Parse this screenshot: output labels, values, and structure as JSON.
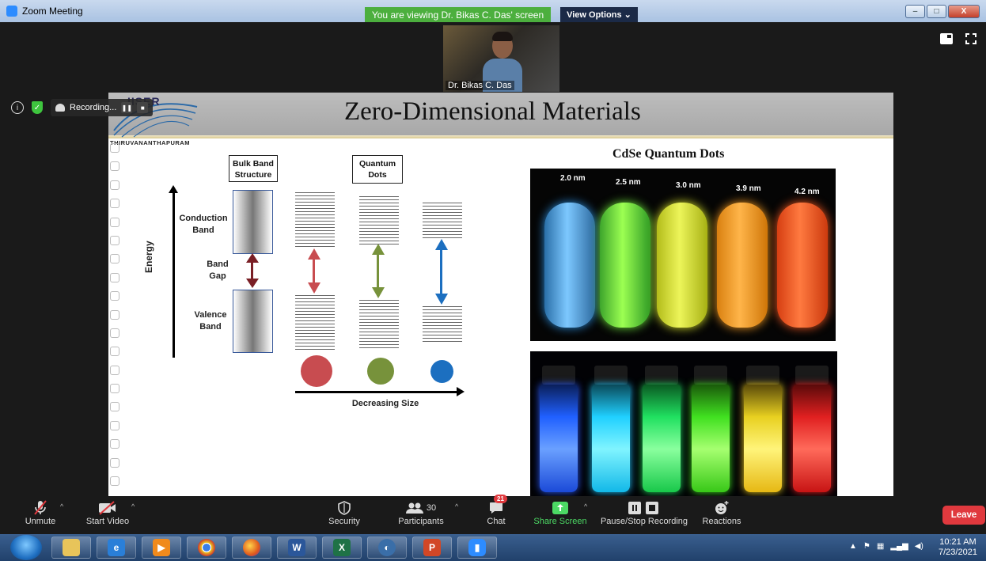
{
  "window": {
    "title": "Zoom Meeting",
    "share_banner": "You are viewing Dr. Bikas C. Das' screen",
    "view_options": "View Options",
    "view_options_caret": "⌄",
    "controls": [
      "minimize-icon",
      "maximize-icon",
      "close-icon"
    ],
    "minimize_glyph": "–",
    "maximize_glyph": "□",
    "close_glyph": "X"
  },
  "video": {
    "participant_name": "Dr. Bikas C. Das"
  },
  "meeting_info": {
    "recording_label": "Recording...",
    "pause_glyph": "❚❚",
    "stop_glyph": "■"
  },
  "slide": {
    "title": "Zero-Dimensional Materials",
    "logo_text": "IISER",
    "logo_subtext": "THIRUVANANTHAPURAM",
    "diagram": {
      "bulk_box": "Bulk Band Structure",
      "qd_box": "Quantum Dots",
      "conduction": "Conduction Band",
      "band_gap": "Band Gap",
      "valence": "Valence Band",
      "energy": "Energy",
      "decreasing": "Decreasing Size",
      "colors": {
        "bulk": "#7a1f25",
        "red": "#c84c50",
        "green": "#77923b",
        "blue": "#1c6fc0"
      }
    },
    "photo_title": "CdSe Quantum Dots",
    "sizes": [
      "2.0 nm",
      "2.5 nm",
      "3.0 nm",
      "3.9 nm",
      "4.2 nm"
    ]
  },
  "toolbar": {
    "unmute": "Unmute",
    "start_video": "Start Video",
    "security": "Security",
    "participants": "Participants",
    "participants_count": "30",
    "chat": "Chat",
    "chat_badge": "21",
    "share_screen": "Share Screen",
    "pause_stop": "Pause/Stop Recording",
    "reactions": "Reactions",
    "leave": "Leave",
    "caret": "^"
  },
  "taskbar": {
    "apps": [
      "file-explorer-icon",
      "internet-explorer-icon",
      "media-player-icon",
      "chrome-icon",
      "firefox-icon",
      "word-icon",
      "excel-icon",
      "app-icon",
      "powerpoint-icon",
      "zoom-icon"
    ],
    "time": "10:21 AM",
    "date": "7/23/2021"
  }
}
